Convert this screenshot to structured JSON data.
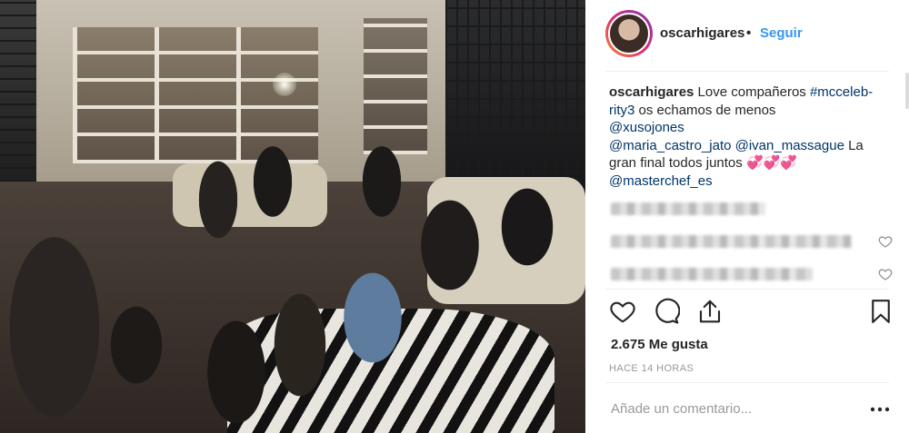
{
  "photo": {
    "description_icon": "group-photo"
  },
  "header": {
    "username": "oscarhigares",
    "separator": "•",
    "follow_label": "Seguir"
  },
  "caption": {
    "username": "oscarhigares",
    "text_1": " Love compañeros ",
    "hashtag": "#mcceleb­rity3",
    "text_2": " os echamos de menos ",
    "mention_1": "@xusojones",
    "mention_2": "@maria_castro_jato",
    "mention_3": "@ivan_massague",
    "text_3": " La gran final todos juntos ",
    "emoji": "💞💞💞",
    "mention_4": "@masterchef_es"
  },
  "comments": [
    {
      "blurred": true,
      "icon": "heart-icon"
    },
    {
      "blurred": true,
      "icon": "heart-icon"
    }
  ],
  "actions": {
    "like_icon": "heart-icon",
    "comment_icon": "comment-icon",
    "share_icon": "share-icon",
    "save_icon": "bookmark-icon"
  },
  "likes": "2.675 Me gusta",
  "timestamp": "HACE 14 HORAS",
  "comment_input": {
    "placeholder": "Añade un comentario..."
  },
  "more_label": "•••",
  "colors": {
    "link": "#003569",
    "follow": "#3897f0",
    "muted": "#999999"
  }
}
